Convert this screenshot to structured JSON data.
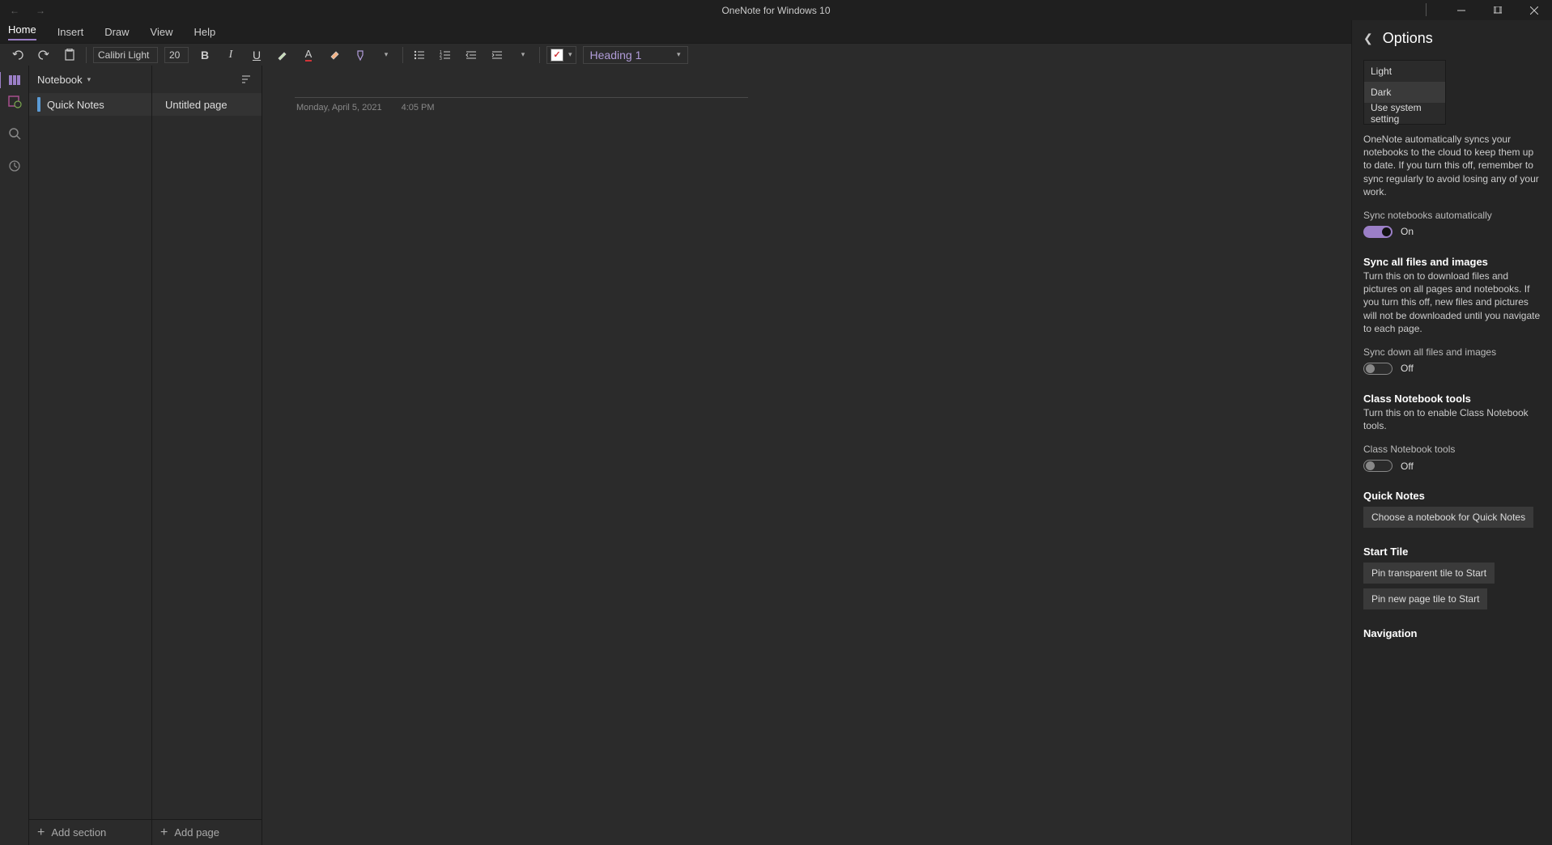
{
  "titlebar": {
    "title": "OneNote for Windows 10"
  },
  "menubar": {
    "home": "Home",
    "insert": "Insert",
    "draw": "Draw",
    "view": "View",
    "help": "Help"
  },
  "ribbon": {
    "font_name": "Calibri Light",
    "font_size": "20",
    "heading_style": "Heading 1"
  },
  "notebook": {
    "name": "Notebook",
    "section": "Quick Notes",
    "page": "Untitled page",
    "add_section": "Add section",
    "add_page": "Add page"
  },
  "canvas": {
    "date": "Monday, April 5, 2021",
    "time": "4:05 PM"
  },
  "options": {
    "title": "Options",
    "theme": {
      "light": "Light",
      "dark": "Dark",
      "system": "Use system setting"
    },
    "sync_auto": {
      "desc": "OneNote automatically syncs your notebooks to the cloud to keep them up to date. If you turn this off, remember to sync regularly to avoid losing any of your work.",
      "label": "Sync notebooks automatically",
      "state": "On"
    },
    "sync_files": {
      "title": "Sync all files and images",
      "desc": "Turn this on to download files and pictures on all pages and notebooks. If you turn this off, new files and pictures will not be downloaded until you navigate to each page.",
      "label": "Sync down all files and images",
      "state": "Off"
    },
    "class_nb": {
      "title": "Class Notebook tools",
      "desc": "Turn this on to enable Class Notebook tools.",
      "label": "Class Notebook tools",
      "state": "Off"
    },
    "quick_notes": {
      "title": "Quick Notes",
      "button": "Choose a notebook for Quick Notes"
    },
    "start_tile": {
      "title": "Start Tile",
      "btn1": "Pin transparent tile to Start",
      "btn2": "Pin new page tile to Start"
    },
    "navigation": {
      "title": "Navigation"
    }
  }
}
